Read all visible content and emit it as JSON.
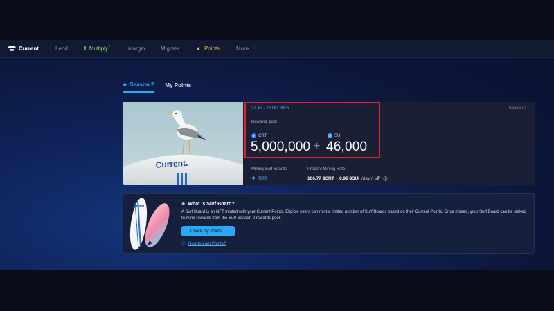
{
  "brand": {
    "name": "Current"
  },
  "nav": {
    "items": [
      {
        "label": "Lend"
      },
      {
        "label": "Multiply",
        "badge": "+"
      },
      {
        "label": "Margin"
      },
      {
        "label": "Migrate"
      },
      {
        "label": "Points",
        "active": true
      },
      {
        "label": "More"
      }
    ]
  },
  "tabs": [
    {
      "label": "Season 2",
      "active": true
    },
    {
      "label": "My Points",
      "active": false
    }
  ],
  "season": {
    "date_range": "22.Jul - 22.Oct 2026",
    "label": "Season 2",
    "rewards_label": "Rewards pool",
    "crt": {
      "token": "CRT",
      "amount": "5,000,000"
    },
    "plus": "+",
    "sui": {
      "token": "SUI",
      "amount": "46,000"
    },
    "mining_label": "Mining Surf Boards",
    "mining_value": "509",
    "rate_label": "Present Mining Rate",
    "rate_value": "106.77 $CRT + 0.98 $SUI",
    "rate_unit": "/day /"
  },
  "surf_board": {
    "title": "What is Surf Board?",
    "description": "A Surf Board is an NFT minted with your Current Points. Eligible users can mint a limited number of Surf Boards based on their Current Points. Once minted, your Surf Board can be staked to mine rewards from the Surf Season 2 rewards pool.",
    "button_label": "Check my Points→",
    "link_label": "How to earn Points?"
  },
  "icons": {
    "logo": "current-logo-icon",
    "points": "flame-icon",
    "tab": "tag-icon",
    "crt": "crt-token-icon",
    "sui": "sui-token-icon",
    "mining": "surfboard-icon",
    "info": "info-icon"
  },
  "colors": {
    "accent": "#2ba8ff",
    "points": "#f5b342",
    "multiply": "#8fe36b",
    "highlight": "#e0222d"
  }
}
